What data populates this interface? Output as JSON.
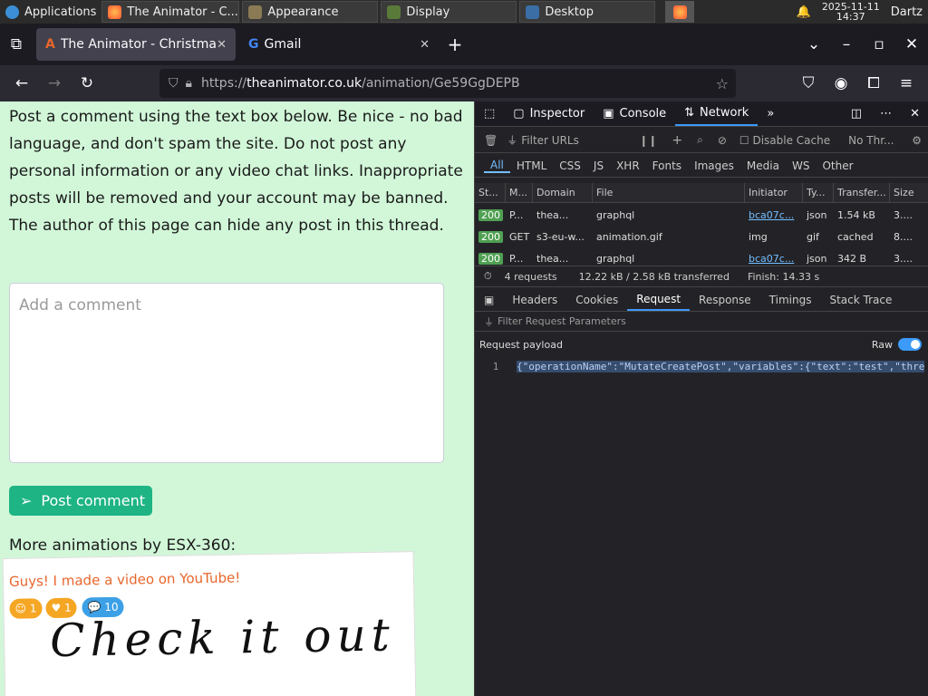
{
  "taskbar": {
    "apps_label": "Applications",
    "tasks": [
      "The Animator - C...",
      "Appearance",
      "Display",
      "Desktop"
    ],
    "date": "2025-11-11",
    "time": "14:37",
    "user": "Dartz"
  },
  "browser": {
    "tabs": [
      {
        "label": "The Animator - Christma",
        "icon": "animator-favicon"
      },
      {
        "label": "Gmail",
        "icon": "google-favicon"
      }
    ],
    "url_prefix": "https://",
    "url_host": "theanimator.co.uk",
    "url_path": "/animation/Ge59GgDEPB"
  },
  "page": {
    "notice": "Post a comment using the text box below. Be nice - no bad language, and don't spam the site. Do not post any personal information or any video chat links. Inappropriate posts will be removed and your account may be banned. The author of this page can hide any post in this thread.",
    "comment_placeholder": "Add a comment",
    "post_button": "Post comment",
    "more_by": "More animations by ESX-360:",
    "card": {
      "title": "Guys! I made a video on YouTube!",
      "likes_a": "1",
      "likes_b": "1",
      "comments": "10",
      "drawing_text": "Check it out"
    }
  },
  "devtools": {
    "tools": [
      "Inspector",
      "Console",
      "Network"
    ],
    "filter_placeholder": "Filter URLs",
    "disable_cache": "Disable Cache",
    "throttle": "No Thr...",
    "type_filters": [
      "All",
      "HTML",
      "CSS",
      "JS",
      "XHR",
      "Fonts",
      "Images",
      "Media",
      "WS",
      "Other"
    ],
    "columns": [
      "St...",
      "M...",
      "Domain",
      "File",
      "Initiator",
      "Ty...",
      "Transfer...",
      "Size"
    ],
    "requests": [
      {
        "status": "200",
        "method": "P...",
        "domain": "thea...",
        "file": "graphql",
        "initiator": "bca07c...",
        "type": "json",
        "transfer": "1.54 kB",
        "size": "3...."
      },
      {
        "status": "200",
        "method": "GET",
        "domain": "s3-eu-w...",
        "file": "animation.gif",
        "initiator": "img",
        "type": "gif",
        "transfer": "cached",
        "size": "8...."
      },
      {
        "status": "200",
        "method": "P...",
        "domain": "thea...",
        "file": "graphql",
        "initiator": "bca07c...",
        "type": "json",
        "transfer": "342 B",
        "size": "3...."
      }
    ],
    "summary": {
      "requests": "4 requests",
      "transferred": "12.22 kB / 2.58 kB transferred",
      "finish": "Finish: 14.33 s"
    },
    "detail_tabs": [
      "Headers",
      "Cookies",
      "Request",
      "Response",
      "Timings",
      "Stack Trace"
    ],
    "param_filter": "Filter Request Parameters",
    "payload_label": "Request payload",
    "raw_label": "Raw",
    "line_no": "1",
    "payload": "{\"operationName\":\"MutateCreatePost\",\"variables\":{\"text\":\"test\",\"thre"
  }
}
